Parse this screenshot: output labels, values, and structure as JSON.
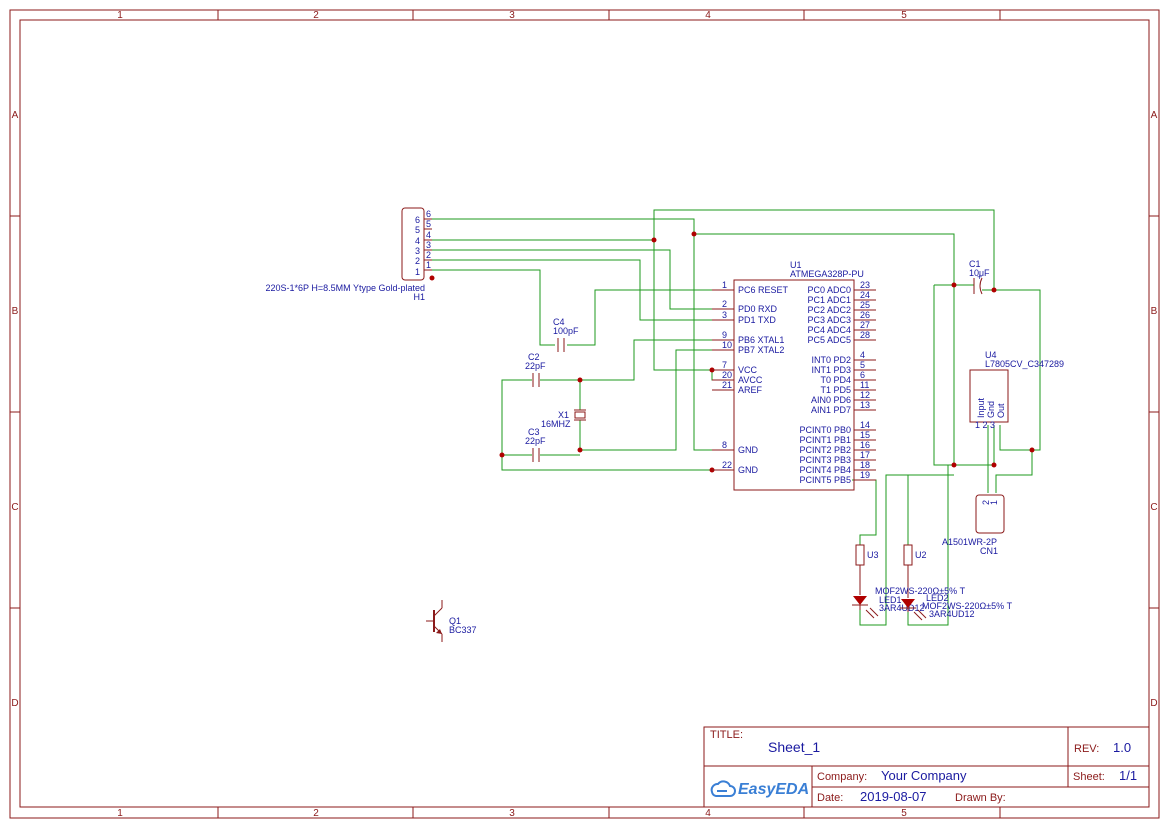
{
  "frame": {
    "columns": [
      "1",
      "2",
      "3",
      "4",
      "5"
    ],
    "rows": [
      "A",
      "B",
      "C",
      "D"
    ]
  },
  "components": {
    "header_h1": {
      "ref": "H1",
      "value": "220S-1*6P H=8.5MM Ytype Gold-plated",
      "pins": [
        "6",
        "5",
        "4",
        "3",
        "2",
        "1"
      ]
    },
    "mcu_u1": {
      "ref": "U1",
      "value": "ATMEGA328P-PU",
      "left_pins": [
        {
          "num": "1",
          "label": "PC6 RESET"
        },
        {
          "num": "2",
          "label": "PD0 RXD"
        },
        {
          "num": "3",
          "label": "PD1 TXD"
        },
        {
          "num": "9",
          "label": "PB6 XTAL1"
        },
        {
          "num": "10",
          "label": "PB7 XTAL2"
        },
        {
          "num": "7",
          "label": "VCC"
        },
        {
          "num": "20",
          "label": "AVCC"
        },
        {
          "num": "21",
          "label": "AREF"
        },
        {
          "num": "8",
          "label": "GND"
        },
        {
          "num": "22",
          "label": "GND"
        }
      ],
      "right_pins": [
        {
          "num": "23",
          "label": "PC0 ADC0"
        },
        {
          "num": "24",
          "label": "PC1 ADC1"
        },
        {
          "num": "25",
          "label": "PC2 ADC2"
        },
        {
          "num": "26",
          "label": "PC3 ADC3"
        },
        {
          "num": "27",
          "label": "PC4 ADC4"
        },
        {
          "num": "28",
          "label": "PC5 ADC5"
        },
        {
          "num": "4",
          "label": "INT0 PD2"
        },
        {
          "num": "5",
          "label": "INT1 PD3"
        },
        {
          "num": "6",
          "label": "T0 PD4"
        },
        {
          "num": "11",
          "label": "T1 PD5"
        },
        {
          "num": "12",
          "label": "AIN0 PD6"
        },
        {
          "num": "13",
          "label": "AIN1 PD7"
        },
        {
          "num": "14",
          "label": "PCINT0 PB0"
        },
        {
          "num": "15",
          "label": "PCINT1 PB1"
        },
        {
          "num": "16",
          "label": "PCINT2 PB2"
        },
        {
          "num": "17",
          "label": "PCINT3 PB3"
        },
        {
          "num": "18",
          "label": "PCINT4 PB4"
        },
        {
          "num": "19",
          "label": "PCINT5 PB5"
        }
      ]
    },
    "cap_c4": {
      "ref": "C4",
      "value": "100pF"
    },
    "cap_c2": {
      "ref": "C2",
      "value": "22pF"
    },
    "cap_c3": {
      "ref": "C3",
      "value": "22pF"
    },
    "crystal_x1": {
      "ref": "X1",
      "value": "16MHZ"
    },
    "cap_c1": {
      "ref": "C1",
      "value": "10uF",
      "polarity": "+"
    },
    "reg_u4": {
      "ref": "U4",
      "value": "L7805CV_C347289",
      "pins": [
        "Input",
        "Gnd",
        "Out"
      ],
      "pin_nums": "1 2 3"
    },
    "conn_cn1": {
      "ref": "CN1",
      "value": "A1501WR-2P",
      "pins": [
        "2",
        "1"
      ]
    },
    "res_u3": {
      "ref": "U3"
    },
    "res_u2": {
      "ref": "U2"
    },
    "led1": {
      "ref": "LED1",
      "value": "3AR4UD12",
      "value_top": "MOF2WS-220Ω±5% T"
    },
    "led2": {
      "ref": "LED2",
      "value": "3AR4UD12",
      "value_top": "MOF2WS-220Ω±5% T"
    },
    "trans_q1": {
      "ref": "Q1",
      "value": "BC337"
    }
  },
  "title_block": {
    "title_label": "TITLE:",
    "title_value": "Sheet_1",
    "rev_label": "REV:",
    "rev_value": "1.0",
    "company_label": "Company:",
    "company_value": "Your Company",
    "sheet_label": "Sheet:",
    "sheet_value": "1/1",
    "date_label": "Date:",
    "date_value": "2019-08-07",
    "drawn_label": "Drawn By:",
    "drawn_value": "",
    "logo_text": "EasyEDA",
    "logo_icon": "cloud-link-icon"
  },
  "colors": {
    "frame": "#8b1a1a",
    "wire": "#1e9a1e",
    "label": "#1a1aa0",
    "junction": "#b00000",
    "logo": "#3a7fd5"
  }
}
